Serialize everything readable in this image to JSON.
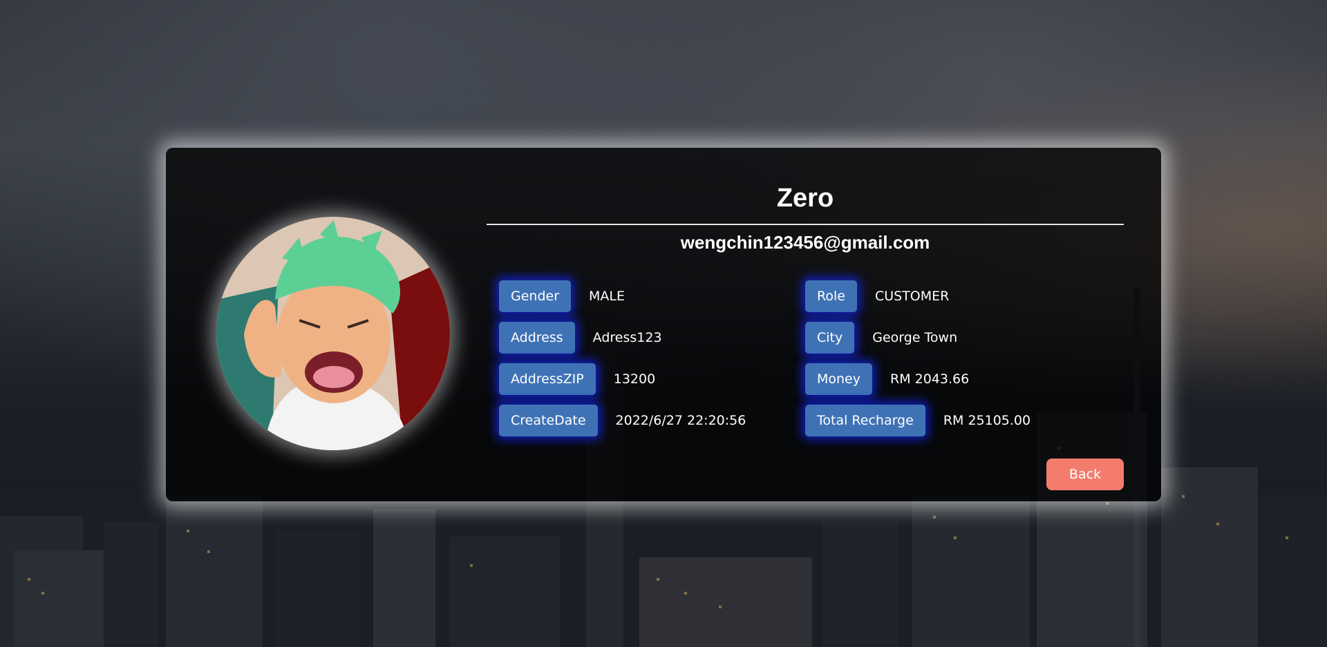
{
  "profile": {
    "name": "Zero",
    "email": "wengchin123456@gmail.com",
    "avatar_icon": "anime-character-avatar"
  },
  "fields_left": [
    {
      "label": "Gender",
      "value": "MALE"
    },
    {
      "label": "Address",
      "value": "Adress123"
    },
    {
      "label": "AddressZIP",
      "value": "13200"
    },
    {
      "label": "CreateDate",
      "value": "2022/6/27 22:20:56"
    }
  ],
  "fields_right": [
    {
      "label": "Role",
      "value": "CUSTOMER"
    },
    {
      "label": "City",
      "value": "George Town"
    },
    {
      "label": "Money",
      "value": "RM 2043.66"
    },
    {
      "label": "Total Recharge",
      "value": "RM 25105.00"
    }
  ],
  "actions": {
    "back_label": "Back"
  },
  "colors": {
    "tag_bg": "#3f72b5",
    "tag_glow": "#1428ff",
    "back_button": "#f47c6c"
  }
}
